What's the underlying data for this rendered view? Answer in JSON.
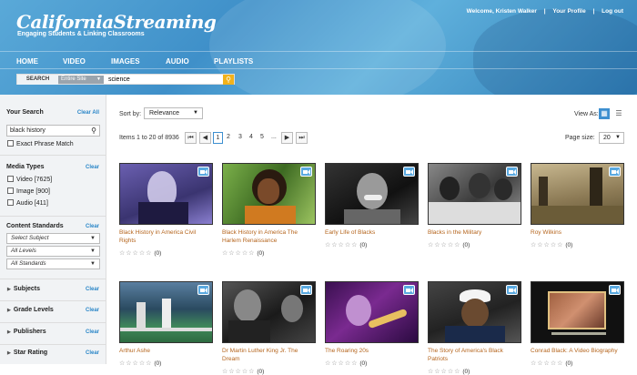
{
  "header": {
    "title": "CaliforniaStreaming",
    "tagline": "Engaging Students & Linking Classrooms",
    "welcome": "Welcome, Kristen Walker",
    "profile": "Your Profile",
    "logout": "Log out",
    "sep": "|"
  },
  "nav": [
    {
      "label": "HOME"
    },
    {
      "label": "VIDEO"
    },
    {
      "label": "IMAGES"
    },
    {
      "label": "AUDIO"
    },
    {
      "label": "PLAYLISTS"
    }
  ],
  "search": {
    "label": "SEARCH",
    "scope": "Entire Site",
    "value": "science"
  },
  "sidebar": {
    "your_search": "Your Search",
    "clear_all": "Clear All",
    "query": "black history",
    "exact": "Exact Phrase Match",
    "media_types": "Media Types",
    "clear": "Clear",
    "media": [
      {
        "label": "Video [7625]"
      },
      {
        "label": "Image [900]"
      },
      {
        "label": "Audio [411]"
      }
    ],
    "content_standards": "Content Standards",
    "selects": [
      {
        "label": "Select Subject"
      },
      {
        "label": "All Levels"
      },
      {
        "label": "All Standards"
      }
    ],
    "folds": [
      {
        "label": "Subjects"
      },
      {
        "label": "Grade Levels"
      },
      {
        "label": "Publishers"
      },
      {
        "label": "Star Rating"
      }
    ]
  },
  "toolbar": {
    "sort_label": "Sort by:",
    "sort_value": "Relevance",
    "view_as": "View As:",
    "items_text": "Items 1 to 20 of 8936",
    "page_size_label": "Page size:",
    "page_size": "20",
    "pages": [
      "1",
      "2",
      "3",
      "4",
      "5"
    ],
    "ellipsis": "..."
  },
  "stars": "☆☆☆☆☆",
  "results": [
    {
      "title": "Black History in America Civil Rights",
      "count": "(0)"
    },
    {
      "title": "Black History in America The Harlem Renaissance",
      "count": "(0)"
    },
    {
      "title": "Early Life of Blacks",
      "count": "(0)"
    },
    {
      "title": "Blacks in the Military",
      "count": "(0)"
    },
    {
      "title": "Roy Wilkins",
      "count": "(0)"
    },
    {
      "title": "Arthur Ashe",
      "count": "(0)"
    },
    {
      "title": "Dr Martin Luther King Jr. The Dream",
      "count": "(0)"
    },
    {
      "title": "The Roaring 20s",
      "count": "(0)"
    },
    {
      "title": "The Story of America's Black Patriots",
      "count": "(0)"
    },
    {
      "title": "Conrad Black: A Video Biography",
      "count": "(0)"
    }
  ]
}
